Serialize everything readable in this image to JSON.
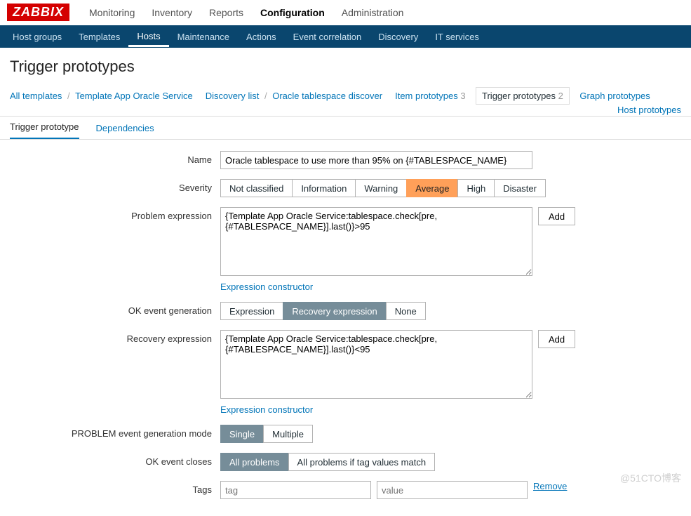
{
  "brand": "ZABBIX",
  "topnav": {
    "items": [
      "Monitoring",
      "Inventory",
      "Reports",
      "Configuration",
      "Administration"
    ],
    "active": "Configuration"
  },
  "subnav": {
    "items": [
      "Host groups",
      "Templates",
      "Hosts",
      "Maintenance",
      "Actions",
      "Event correlation",
      "Discovery",
      "IT services"
    ],
    "active": "Hosts"
  },
  "page_title": "Trigger prototypes",
  "crumbs": {
    "all_templates": "All templates",
    "template_name": "Template App Oracle Service",
    "discovery_list": "Discovery list",
    "discovery_rule": "Oracle tablespace discover",
    "item_proto_label": "Item prototypes",
    "item_proto_count": "3",
    "trigger_proto_label": "Trigger prototypes",
    "trigger_proto_count": "2",
    "graph_proto": "Graph prototypes",
    "host_proto": "Host prototypes"
  },
  "tabs": {
    "main": "Trigger prototype",
    "deps": "Dependencies"
  },
  "form": {
    "name_label": "Name",
    "name_value": "Oracle tablespace to use more than 95% on {#TABLESPACE_NAME}",
    "severity_label": "Severity",
    "severity_options": [
      "Not classified",
      "Information",
      "Warning",
      "Average",
      "High",
      "Disaster"
    ],
    "problem_expr_label": "Problem expression",
    "problem_expr_value": "{Template App Oracle Service:tablespace.check[pre,{#TABLESPACE_NAME}].last()}>95",
    "add_btn": "Add",
    "expr_constructor": "Expression constructor",
    "ok_gen_label": "OK event generation",
    "ok_gen_options": [
      "Expression",
      "Recovery expression",
      "None"
    ],
    "recovery_expr_label": "Recovery expression",
    "recovery_expr_value": "{Template App Oracle Service:tablespace.check[pre,{#TABLESPACE_NAME}].last()}<95",
    "problem_mode_label": "PROBLEM event generation mode",
    "problem_mode_options": [
      "Single",
      "Multiple"
    ],
    "ok_closes_label": "OK event closes",
    "ok_closes_options": [
      "All problems",
      "All problems if tag values match"
    ],
    "tags_label": "Tags",
    "tag_placeholder": "tag",
    "value_placeholder": "value",
    "remove": "Remove"
  },
  "watermark": "@51CTO博客"
}
